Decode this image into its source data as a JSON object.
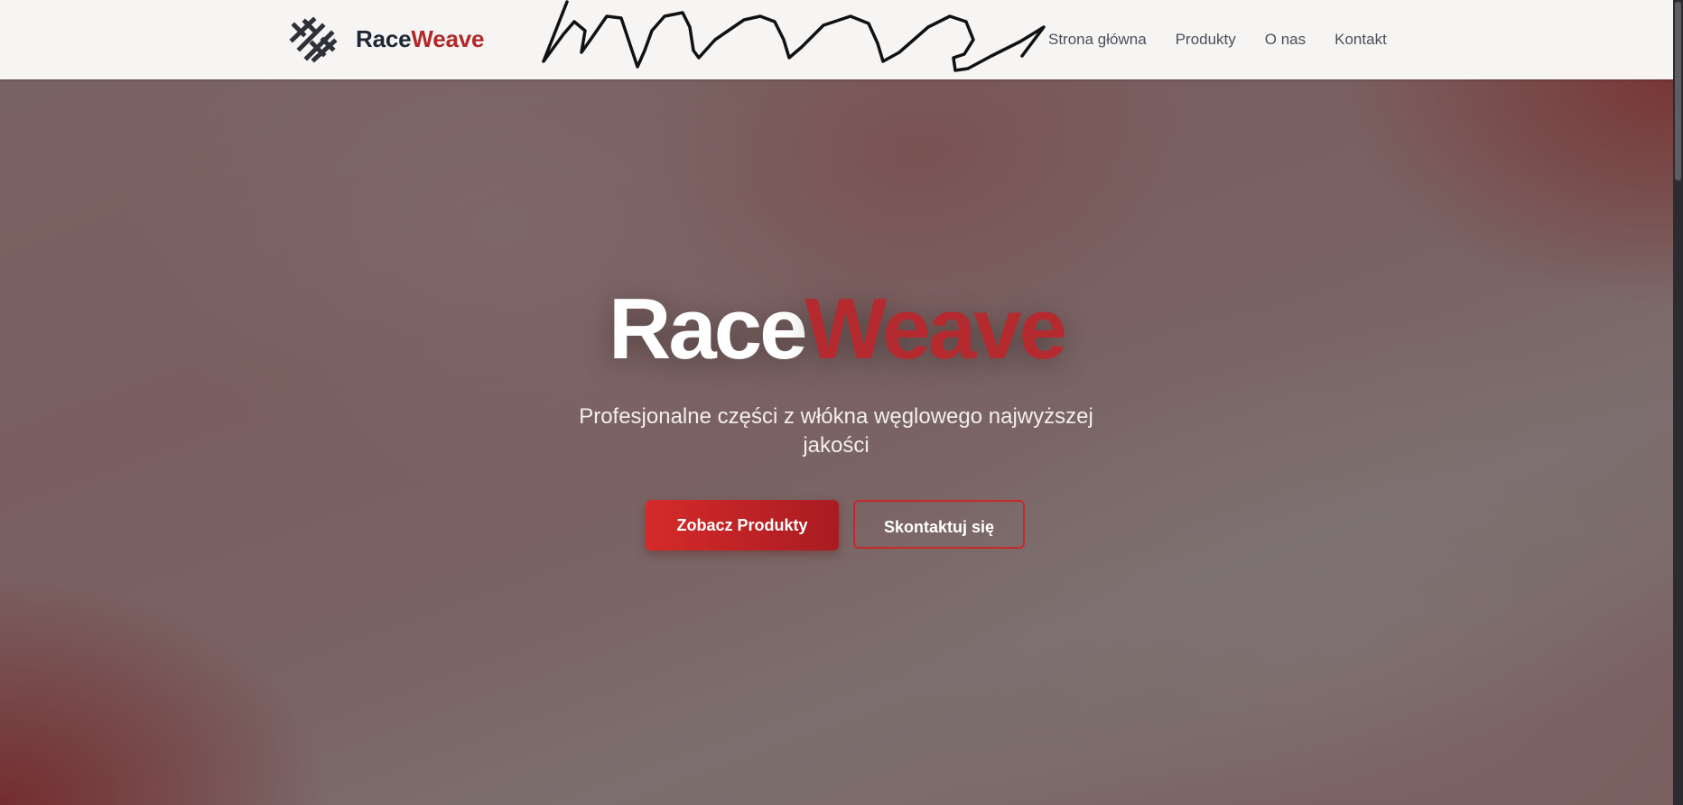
{
  "header": {
    "brand_part1": "Race",
    "brand_part2": "Weave",
    "logo_icon": "carbon-weave-logo-icon",
    "nav": [
      {
        "label": "Strona główna"
      },
      {
        "label": "Produkty"
      },
      {
        "label": "O nas"
      },
      {
        "label": "Kontakt"
      }
    ]
  },
  "hero": {
    "title_part1": "Race",
    "title_part2": "Weave",
    "subtitle": "Profesjonalne części z włókna węglowego najwyższej jakości",
    "primary_button": "Zobacz Produkty",
    "secondary_button": "Skontaktuj się"
  },
  "colors": {
    "accent": "#b02a2a",
    "header_bg": "#f7f5f4",
    "primary_button_start": "#d62a2a",
    "primary_button_end": "#a81c22"
  }
}
